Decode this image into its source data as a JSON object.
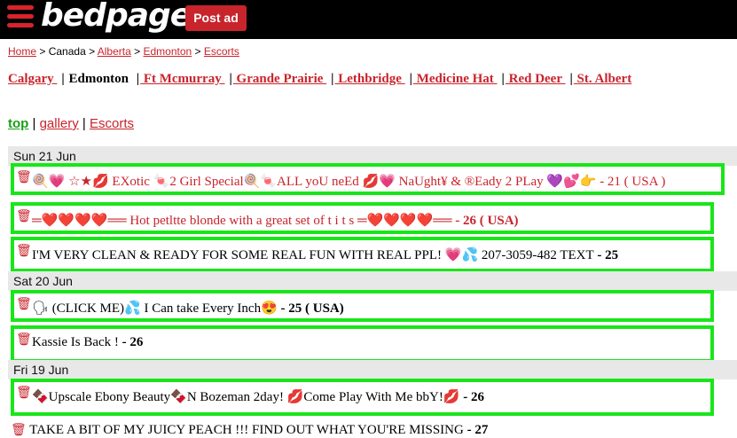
{
  "header": {
    "logo": "bedpage",
    "post_ad": "Post ad"
  },
  "breadcrumb": {
    "home": "Home",
    "sep": " > ",
    "canada": "Canada",
    "alberta": "Alberta",
    "edmonton": "Edmonton",
    "escorts": "Escorts"
  },
  "cities": {
    "calgary": "Calgary ",
    "edmonton": "Edmonton ",
    "ft_mcmurray": " Ft Mcmurray ",
    "grande_prairie": " Grande Prairie ",
    "lethbridge": " Lethbridge ",
    "medicine_hat": " Medicine Hat ",
    "red_deer": " Red Deer ",
    "st_albert": " St. Albert",
    "bar": "|"
  },
  "toplinks": {
    "top": "top",
    "gallery": "gallery",
    "escorts": "Escorts",
    "bar": " | "
  },
  "dates": {
    "d1": "Sun 21 Jun",
    "d2": "Sat 20 Jun",
    "d3": "Fri 19 Jun"
  },
  "listings": [
    {
      "title": "🍭💗 ☆★💋 EXotic 🍬2 Girl Special🍭🍬ALL yoU neEd 💋💗 NaUght¥ & ®Eady 2 PLay 💜💕👉",
      "meta": " - 21 ( USA )"
    },
    {
      "title": "═❤️❤️❤️❤️══ Hot petltte blonde with a great set of t i t s ═❤️❤️❤️❤️══",
      "meta": " - 26 ( USA)"
    },
    {
      "title": "I'M VERY CLEAN & READY FOR SOME REAL FUN WITH REAL PPL! 💗💦 207-3059-482 TEXT",
      "meta": " - 25"
    },
    {
      "title": "🗣 (CLICK ME)💦 I Can take Every Inch😍",
      "meta": " - 25 ( USA)"
    },
    {
      "title": "Kassie Is Back !",
      "meta": " - 26"
    },
    {
      "title": "🍫Upscale Ebony Beauty🍫N Bozeman 2day! 💋Come Play With Me bbY!💋",
      "meta": " - 26"
    },
    {
      "title": "TAKE A BIT OF MY JUICY PEACH !!!               FIND OUT WHAT YOU'RE MISSING",
      "meta": " - 27"
    }
  ],
  "icons": {
    "trash": "🗑",
    "menu": "hamburger-icon"
  },
  "colors": {
    "brand_red": "#c8242c",
    "highlight_green": "#19e619"
  }
}
